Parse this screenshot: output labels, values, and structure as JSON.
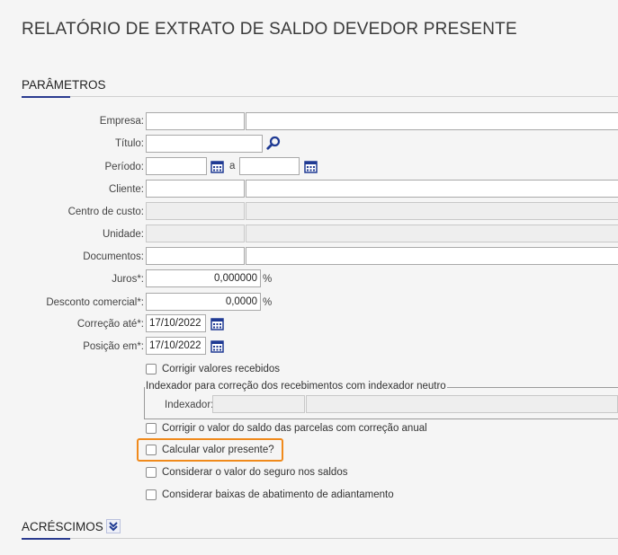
{
  "page": {
    "title": "RELATÓRIO DE EXTRATO DE SALDO DEVEDOR PRESENTE"
  },
  "sections": {
    "parametros": "PARÂMETROS",
    "acrescimos": "ACRÉSCIMOS"
  },
  "form": {
    "empresa": {
      "label": "Empresa:",
      "code": "",
      "name": ""
    },
    "titulo": {
      "label": "Título:",
      "value": ""
    },
    "periodo": {
      "label": "Período:",
      "start": "",
      "separator": "a",
      "end": ""
    },
    "cliente": {
      "label": "Cliente:",
      "code": "",
      "name": ""
    },
    "centro_custo": {
      "label": "Centro de custo:",
      "code": "",
      "name": ""
    },
    "unidade": {
      "label": "Unidade:",
      "code": "",
      "name": ""
    },
    "documentos": {
      "label": "Documentos:",
      "code": "",
      "name": ""
    },
    "juros": {
      "label": "Juros*:",
      "value": "0,000000",
      "unit": "%"
    },
    "desconto_comercial": {
      "label": "Desconto comercial*:",
      "value": "0,0000",
      "unit": "%"
    },
    "correcao_ate": {
      "label": "Correção até*:",
      "value": "17/10/2022"
    },
    "posicao_em": {
      "label": "Posição em*:",
      "value": "17/10/2022"
    }
  },
  "checkboxes": {
    "corrigir_valores": {
      "label": "Corrigir valores recebidos",
      "checked": false
    },
    "corrigir_saldo": {
      "label": "Corrigir o valor do saldo das parcelas com correção anual",
      "checked": false
    },
    "calcular_presente": {
      "label": "Calcular valor presente?",
      "checked": false
    },
    "considerar_seguro": {
      "label": "Considerar o valor do seguro nos saldos",
      "checked": false
    },
    "considerar_baixas": {
      "label": "Considerar baixas de abatimento de adiantamento",
      "checked": false
    }
  },
  "indexador_group": {
    "legend": "Indexador para correção dos recebimentos com indexador neutro",
    "label": "Indexador:",
    "code": "",
    "name": ""
  },
  "colors": {
    "accent": "#2a3b8f",
    "highlight": "#f08a1c",
    "icon": "#1f3a93"
  }
}
